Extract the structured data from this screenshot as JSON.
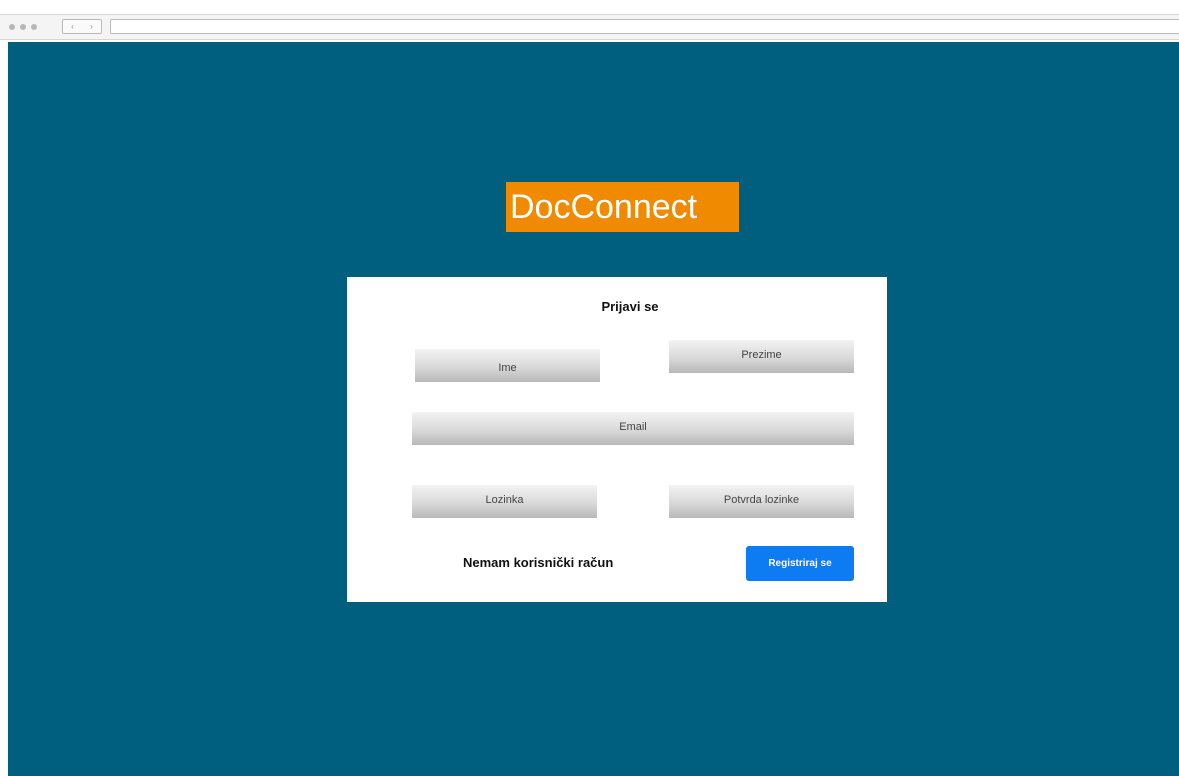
{
  "browser": {
    "nav_back_glyph": "‹",
    "nav_forward_glyph": "›"
  },
  "logo": {
    "text": "DocConnect",
    "background_color": "#f08a00"
  },
  "page": {
    "background_color": "#005f7f"
  },
  "form": {
    "title": "Prijavi se",
    "fields": {
      "first_name": "Ime",
      "last_name": "Prezime",
      "email": "Email",
      "password": "Lozinka",
      "confirm_password": "Potvrda lozinke"
    },
    "no_account_text": "Nemam korisnički račun",
    "register_button_label": "Registriraj se",
    "register_button_color": "#0d7bf2"
  }
}
